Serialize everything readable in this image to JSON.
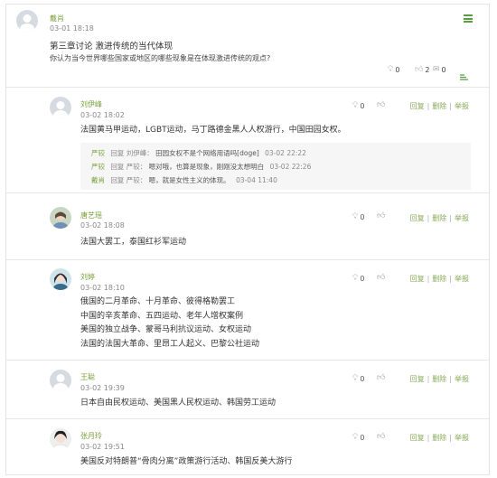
{
  "post": {
    "author": "戴肖",
    "date": "03-01 18:18",
    "title": "第三章讨论 激进传统的当代体现",
    "question": "你认为当今世界哪些国家或地区的哪些现象是在体现激进传统的观点?",
    "bulb_count": "0",
    "like_count": "2",
    "comment_count": "0"
  },
  "comments": [
    {
      "author": "刘伊峰",
      "date": "03-02 18:02",
      "lines": [
        "法国黄马甲运动，LGBT运动，马丁路德金黑人人权游行，中国田园女权。"
      ],
      "bulb_count": "0",
      "replies": [
        {
          "name": "严较",
          "reply_word": "回复",
          "target": "刘伊峰：",
          "text": "田园女权不是个网络用语吗[doge]",
          "date": "03-02 22:22"
        },
        {
          "name": "严较",
          "reply_word": "回复",
          "target": "严较：",
          "text": "嗯对哦，也算是现象，刚刚没太想明白",
          "date": "03-02 22:26"
        },
        {
          "name": "戴肖",
          "reply_word": "回复",
          "target": "严较：",
          "text": "嗯，就是女性主义的体现。",
          "date": "03-04 11:40"
        }
      ]
    },
    {
      "author": "唐艺瑶",
      "date": "03-02 18:08",
      "lines": [
        "法国大罢工，泰国红衫军运动"
      ],
      "bulb_count": "0"
    },
    {
      "author": "刘婷",
      "date": "03-02 18:10",
      "lines": [
        "俄国的二月革命、十月革命、彼得格勒罢工",
        "中国的辛亥革命、五四运动、老年人增权案例",
        "美国的独立战争、蒙哥马利抗议运动、女权运动",
        "法国的法国大革命、里昂工人起义、巴黎公社运动"
      ],
      "bulb_count": "0"
    },
    {
      "author": "王聪",
      "date": "03-02 19:39",
      "lines": [
        "日本自由民权运动、美国黑人民权运动、韩国劳工运动"
      ],
      "bulb_count": "0"
    },
    {
      "author": "张月玲",
      "date": "03-02 19:51",
      "lines": [
        "美国反对特朗普“骨肉分离”政策游行活动、韩国反美大游行"
      ],
      "bulb_count": "0"
    }
  ],
  "actions": {
    "reply": "回复",
    "delete": "删除",
    "report": "举报",
    "sep": "|"
  },
  "icons": {
    "menu": "hamburger-menu-icon",
    "bulb": "lightbulb-icon",
    "thumb": "thumbs-up-icon",
    "comment": "comment-icon"
  },
  "colors": {
    "accent": "#7aa13e",
    "menu": "#5a9e43",
    "reply_bg": "#f6f6f6"
  }
}
